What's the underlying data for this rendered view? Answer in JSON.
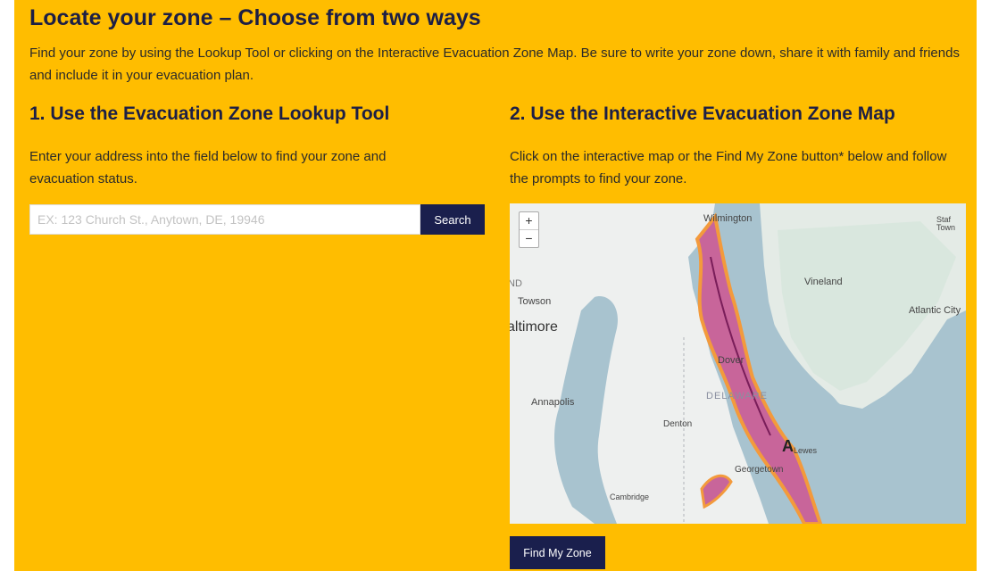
{
  "heading": "Locate your zone – Choose from two ways",
  "intro": "Find your zone by using the Lookup Tool or clicking on the Interactive Evacuation Zone Map. Be sure to write your zone down, share it with family and friends and include it in your evacuation plan.",
  "lookup": {
    "title": "1. Use the Evacuation Zone Lookup Tool",
    "description": "Enter your address into the field below to find your zone and evacuation status.",
    "placeholder": "EX: 123 Church St., Anytown, DE, 19946",
    "search_label": "Search"
  },
  "map_section": {
    "title": "2. Use the Interactive Evacuation Zone Map",
    "description": "Click on the interactive map or the Find My Zone button* below and follow the prompts to find your zone.",
    "find_label": "Find My Zone",
    "zoom_in": "+",
    "zoom_out": "−",
    "labels": {
      "wilmington": "Wilmington",
      "vineland": "Vineland",
      "towson": "Towson",
      "baltimore": "altimore",
      "atlantic_city": "Atlantic City",
      "dover": "Dover",
      "delaware": "DELAWARE",
      "annapolis": "Annapolis",
      "denton": "Denton",
      "lewes": "Lewes",
      "georgetown": "Georgetown",
      "cambridge": "Cambridge",
      "staff_town": "Staf\nTown",
      "nd": "ND"
    },
    "pin_letter": "A"
  },
  "colors": {
    "panel": "#FFBD00",
    "heading": "#1d1f45",
    "button": "#1a1f4d",
    "zone_fill": "#c8659a",
    "zone_edge": "#f39a3c"
  }
}
